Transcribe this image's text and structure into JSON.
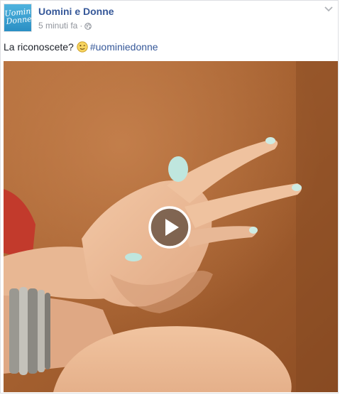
{
  "post": {
    "page_name": "Uomini e Donne",
    "avatar_text": "Uomini\nDonne",
    "timestamp": "5 minuti fa",
    "separator": "·",
    "privacy_icon": "globe-icon",
    "menu_icon": "chevron-down-icon",
    "message": {
      "text": "La riconoscete?",
      "emoji": "wink-emoji-icon",
      "hashtag": "#uominiedonne"
    },
    "video": {
      "play_icon": "play-icon"
    }
  },
  "colors": {
    "link": "#365899",
    "meta": "#90949c",
    "text": "#1d2129"
  }
}
